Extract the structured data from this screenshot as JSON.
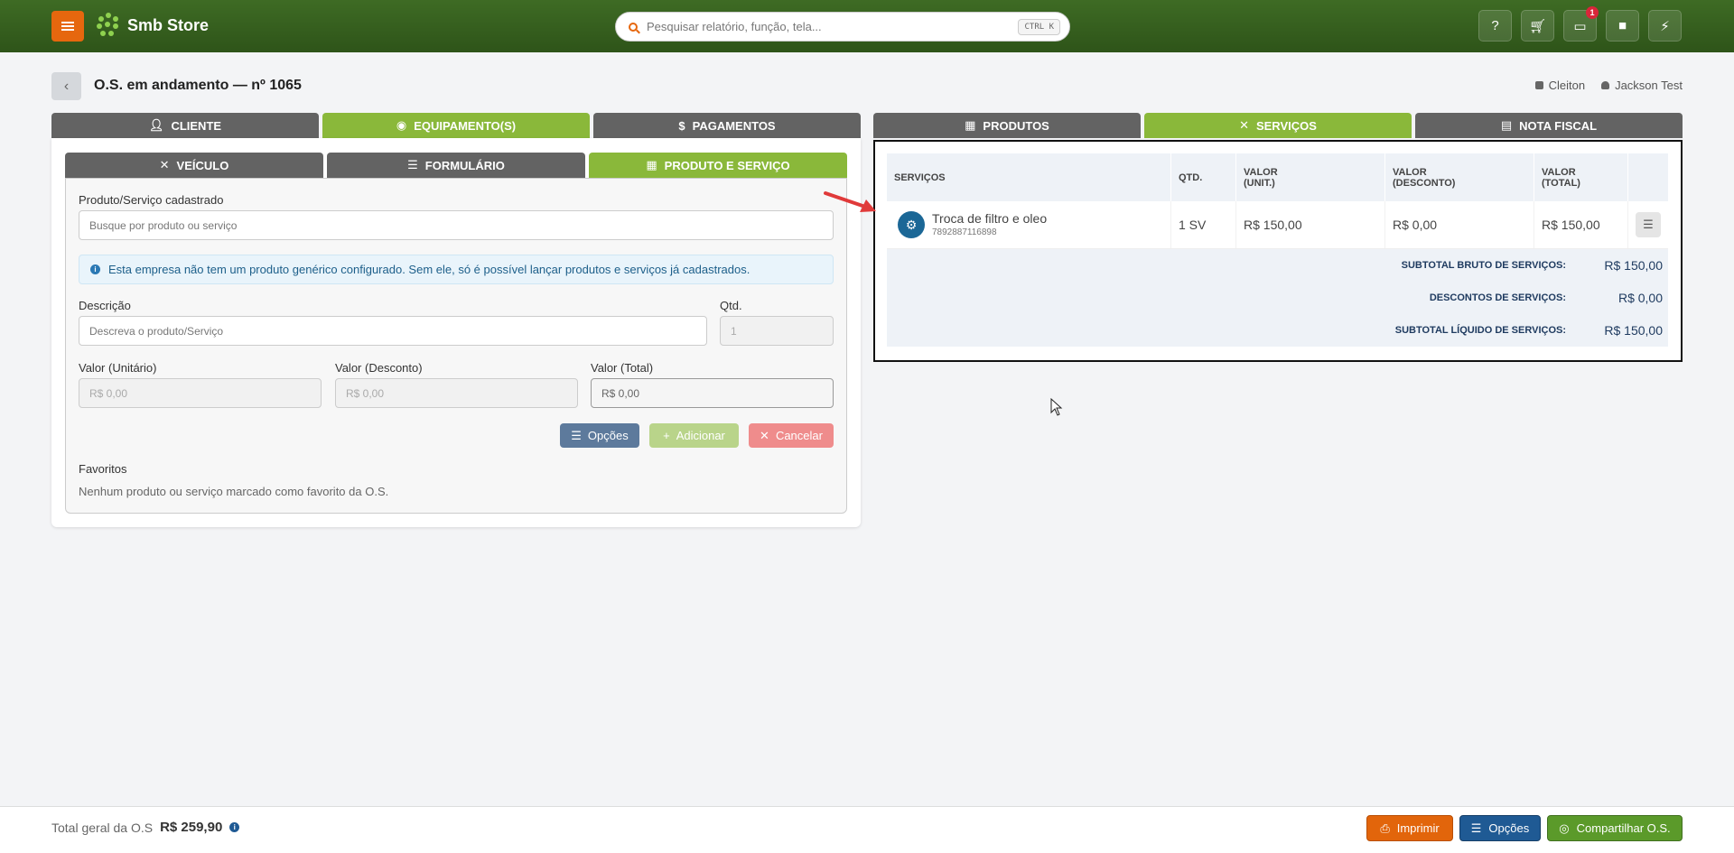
{
  "topbar": {
    "brand": "Smb Store",
    "search_placeholder": "Pesquisar relatório, função, tela...",
    "search_shortcut": "CTRL K",
    "notifications_badge": "1",
    "icons": [
      "help-icon",
      "cart-icon",
      "monitor-icon",
      "chat-icon",
      "bolt-icon"
    ]
  },
  "header": {
    "title": "O.S. em andamento — nº 1065",
    "store": "Cleiton",
    "user": "Jackson Test"
  },
  "left_tabs": [
    {
      "label": "Cliente",
      "active": false
    },
    {
      "label": "Equipamento(s)",
      "active": true
    },
    {
      "label": "Pagamentos",
      "active": false
    }
  ],
  "sub_tabs": [
    {
      "label": "Veículo",
      "active": false
    },
    {
      "label": "Formulário",
      "active": false
    },
    {
      "label": "Produto e Serviço",
      "active": true
    }
  ],
  "form": {
    "product_label": "Produto/Serviço cadastrado",
    "product_placeholder": "Busque por produto ou serviço",
    "alert": "Esta empresa não tem um produto genérico configurado. Sem ele, só é possível lançar produtos e serviços já cadastrados.",
    "description_label": "Descrição",
    "description_placeholder": "Descreva o produto/Serviço",
    "qty_label": "Qtd.",
    "qty_value": "1",
    "unit_label": "Valor (Unitário)",
    "unit_value": "R$ 0,00",
    "discount_label": "Valor (Desconto)",
    "discount_value": "R$ 0,00",
    "total_label": "Valor (Total)",
    "total_value": "R$ 0,00",
    "btn_options": "Opções",
    "btn_add": "Adicionar",
    "btn_cancel": "Cancelar",
    "favorites_label": "Favoritos",
    "favorites_empty": "Nenhum produto ou serviço marcado como favorito da O.S."
  },
  "right_tabs": [
    {
      "label": "Produtos",
      "active": false
    },
    {
      "label": "Serviços",
      "active": true
    },
    {
      "label": "Nota Fiscal",
      "active": false
    }
  ],
  "services": {
    "headers": {
      "name": "SERVIÇOS",
      "qty": "QTD.",
      "unit_1": "VALOR",
      "unit_2": "(UNIT.)",
      "disc_1": "VALOR",
      "disc_2": "(DESCONTO)",
      "tot_1": "VALOR",
      "tot_2": "(TOTAL)"
    },
    "rows": [
      {
        "name": "Troca de filtro e oleo",
        "code": "7892887116898",
        "qty": "1 SV",
        "unit": "R$ 150,00",
        "discount": "R$ 0,00",
        "total": "R$ 150,00"
      }
    ],
    "totals": {
      "gross_label": "SUBTOTAL BRUTO DE SERVIÇOS:",
      "gross_value": "R$ 150,00",
      "disc_label": "DESCONTOS DE SERVIÇOS:",
      "disc_value": "R$ 0,00",
      "net_label": "SUBTOTAL LÍQUIDO DE SERVIÇOS:",
      "net_value": "R$ 150,00"
    }
  },
  "footer": {
    "total_label": "Total geral da O.S",
    "total_value": "R$ 259,90",
    "btn_print": "Imprimir",
    "btn_options": "Opções",
    "btn_share": "Compartilhar O.S."
  }
}
